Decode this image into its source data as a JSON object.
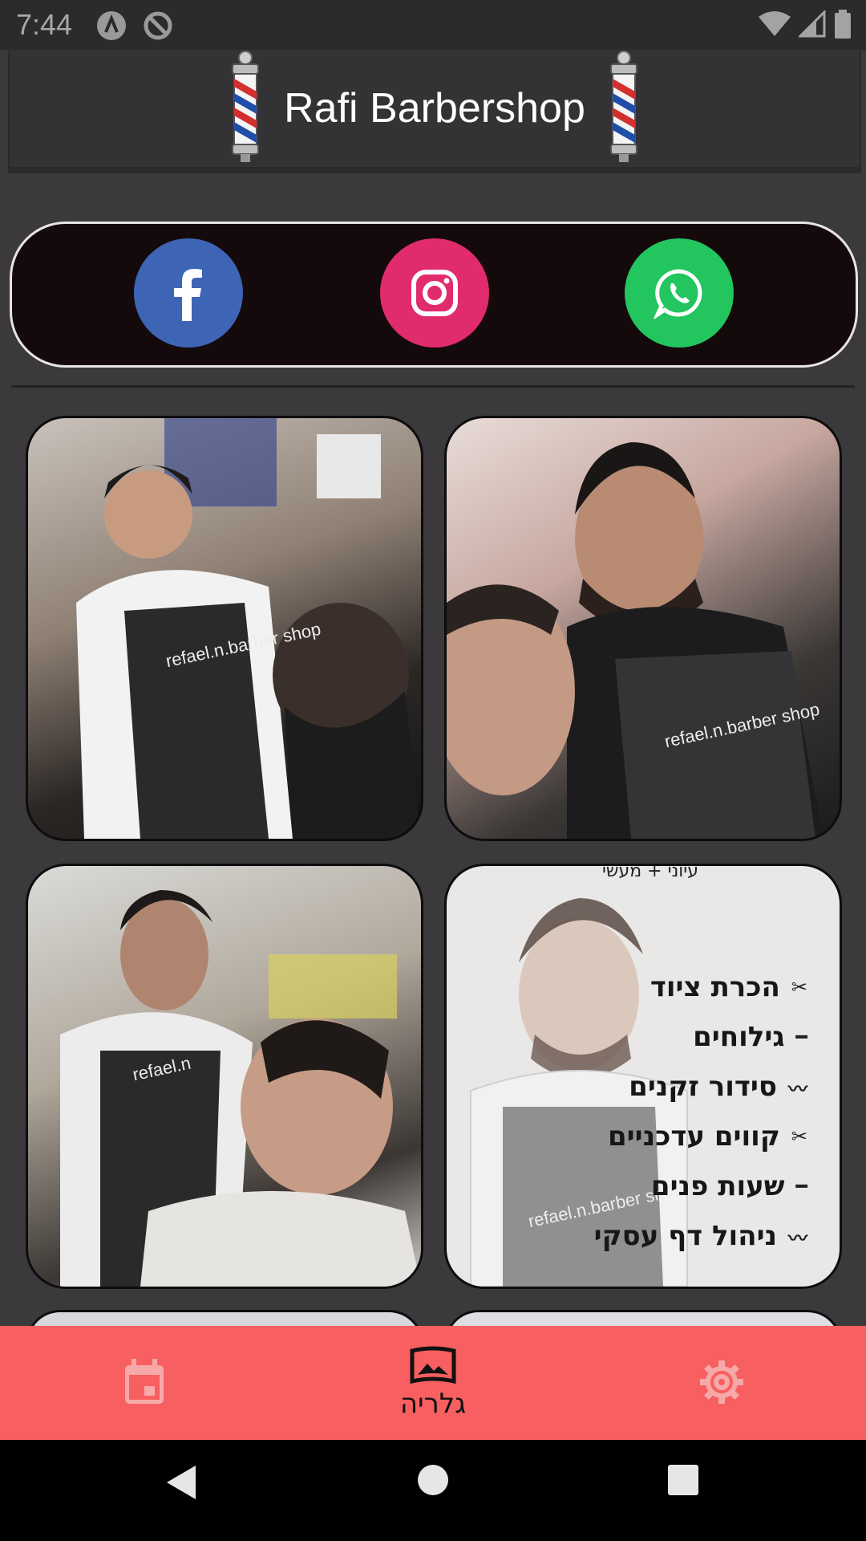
{
  "status_bar": {
    "time": "7:44",
    "icons": [
      "autofill-a-icon",
      "do-not-disturb-icon",
      "wifi-icon",
      "signal-icon",
      "battery-icon"
    ]
  },
  "app_bar": {
    "title": "Rafi Barbershop",
    "icon": "barber-pole-icon"
  },
  "social": [
    {
      "name": "facebook",
      "icon": "facebook-icon",
      "color": "#3e64b6"
    },
    {
      "name": "instagram",
      "icon": "instagram-icon",
      "color": "#e02c6c"
    },
    {
      "name": "whatsapp",
      "icon": "whatsapp-icon",
      "color": "#22c55e"
    }
  ],
  "gallery": {
    "photo_captions": [
      "refael.n.barber shop",
      "refael.n.barber shop",
      "refael.n",
      "refael.n.barber shop"
    ],
    "flyer": {
      "top_text": "עיוני + מעשי",
      "items": [
        "הכרת ציוד",
        "גילוחים",
        "סידור זקנים",
        "קווים עדכניים",
        "שעות פנים",
        "ניהול דף עסקי"
      ]
    }
  },
  "bottom_nav": {
    "items": [
      {
        "icon": "calendar-icon",
        "label": ""
      },
      {
        "icon": "gallery-icon",
        "label": "גלריה",
        "active": true
      },
      {
        "icon": "gear-icon",
        "label": ""
      }
    ],
    "background": "#f75f60",
    "inactive_color": "#f7a8a8"
  },
  "system_nav": [
    "back-icon",
    "home-icon",
    "recents-icon"
  ]
}
